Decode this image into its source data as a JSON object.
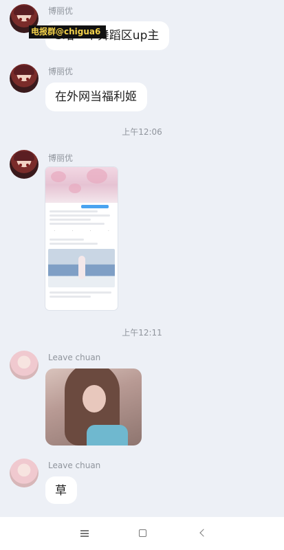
{
  "watermark": "电报群@chigua6",
  "messages": [
    {
      "sender": "博丽优",
      "text": "S站一个舞蹈区up主"
    },
    {
      "sender": "博丽优",
      "text": "在外网当福利姬"
    },
    {
      "timestamp": "上午12:06"
    },
    {
      "sender": "博丽优",
      "type": "image"
    },
    {
      "timestamp": "上午12:11"
    },
    {
      "sender": "Leave chuan",
      "type": "image"
    },
    {
      "sender": "Leave chuan",
      "text": "草"
    }
  ],
  "nav": {
    "menu_icon": "menu-icon",
    "home_icon": "home-icon",
    "back_icon": "back-icon"
  }
}
